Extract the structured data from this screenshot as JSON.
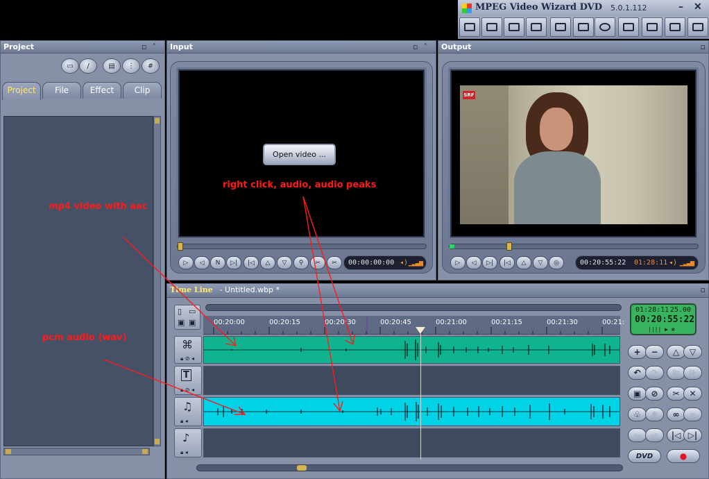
{
  "app": {
    "title": "MPEG Video Wizard DVD",
    "version": "5.0.1.112"
  },
  "panels": {
    "project": "Project",
    "input": "Input",
    "output": "Output",
    "timeline": "Time Line",
    "timeline_file": "- Untitled.wbp *"
  },
  "project_tabs": [
    "Project",
    "File",
    "Effect",
    "Clip"
  ],
  "input": {
    "open_video_label": "Open video ...",
    "timecode": "00:00:00:00"
  },
  "output": {
    "timecode": "00:20:55:22",
    "duration": "01:28:11",
    "channel_logo": "SRF"
  },
  "timeline": {
    "ticks": [
      "00:20:00",
      "00:20:15",
      "00:20:30",
      "00:20:45",
      "00:21:00",
      "00:21:15",
      "00:21:30",
      "00:21:"
    ],
    "lcd_duration": "01:28:11",
    "lcd_fps": "25.00",
    "lcd_timecode": "00:20:55:22",
    "dvd_label": "DVD"
  },
  "annotations": {
    "right_click": "right click, audio, audio peaks",
    "mp4": "mp4 video with aac",
    "pcm": "pcm audio (wav)"
  },
  "colors": {
    "video_track": "#0fb38f",
    "audio_track": "#00d3e6",
    "annotation": "#ff1a1a",
    "active_tab_text": "#ffe86a",
    "lcd_bg": "#39b35f"
  },
  "icons": {
    "toolbar": [
      "clapper-icon",
      "film-icon",
      "monitor-icon",
      "monitor-2-icon",
      "keyboard-icon",
      "edit-icon",
      "dvd-icon",
      "export-icon",
      "layout-icon",
      "tag-icon",
      "exit-icon"
    ]
  }
}
